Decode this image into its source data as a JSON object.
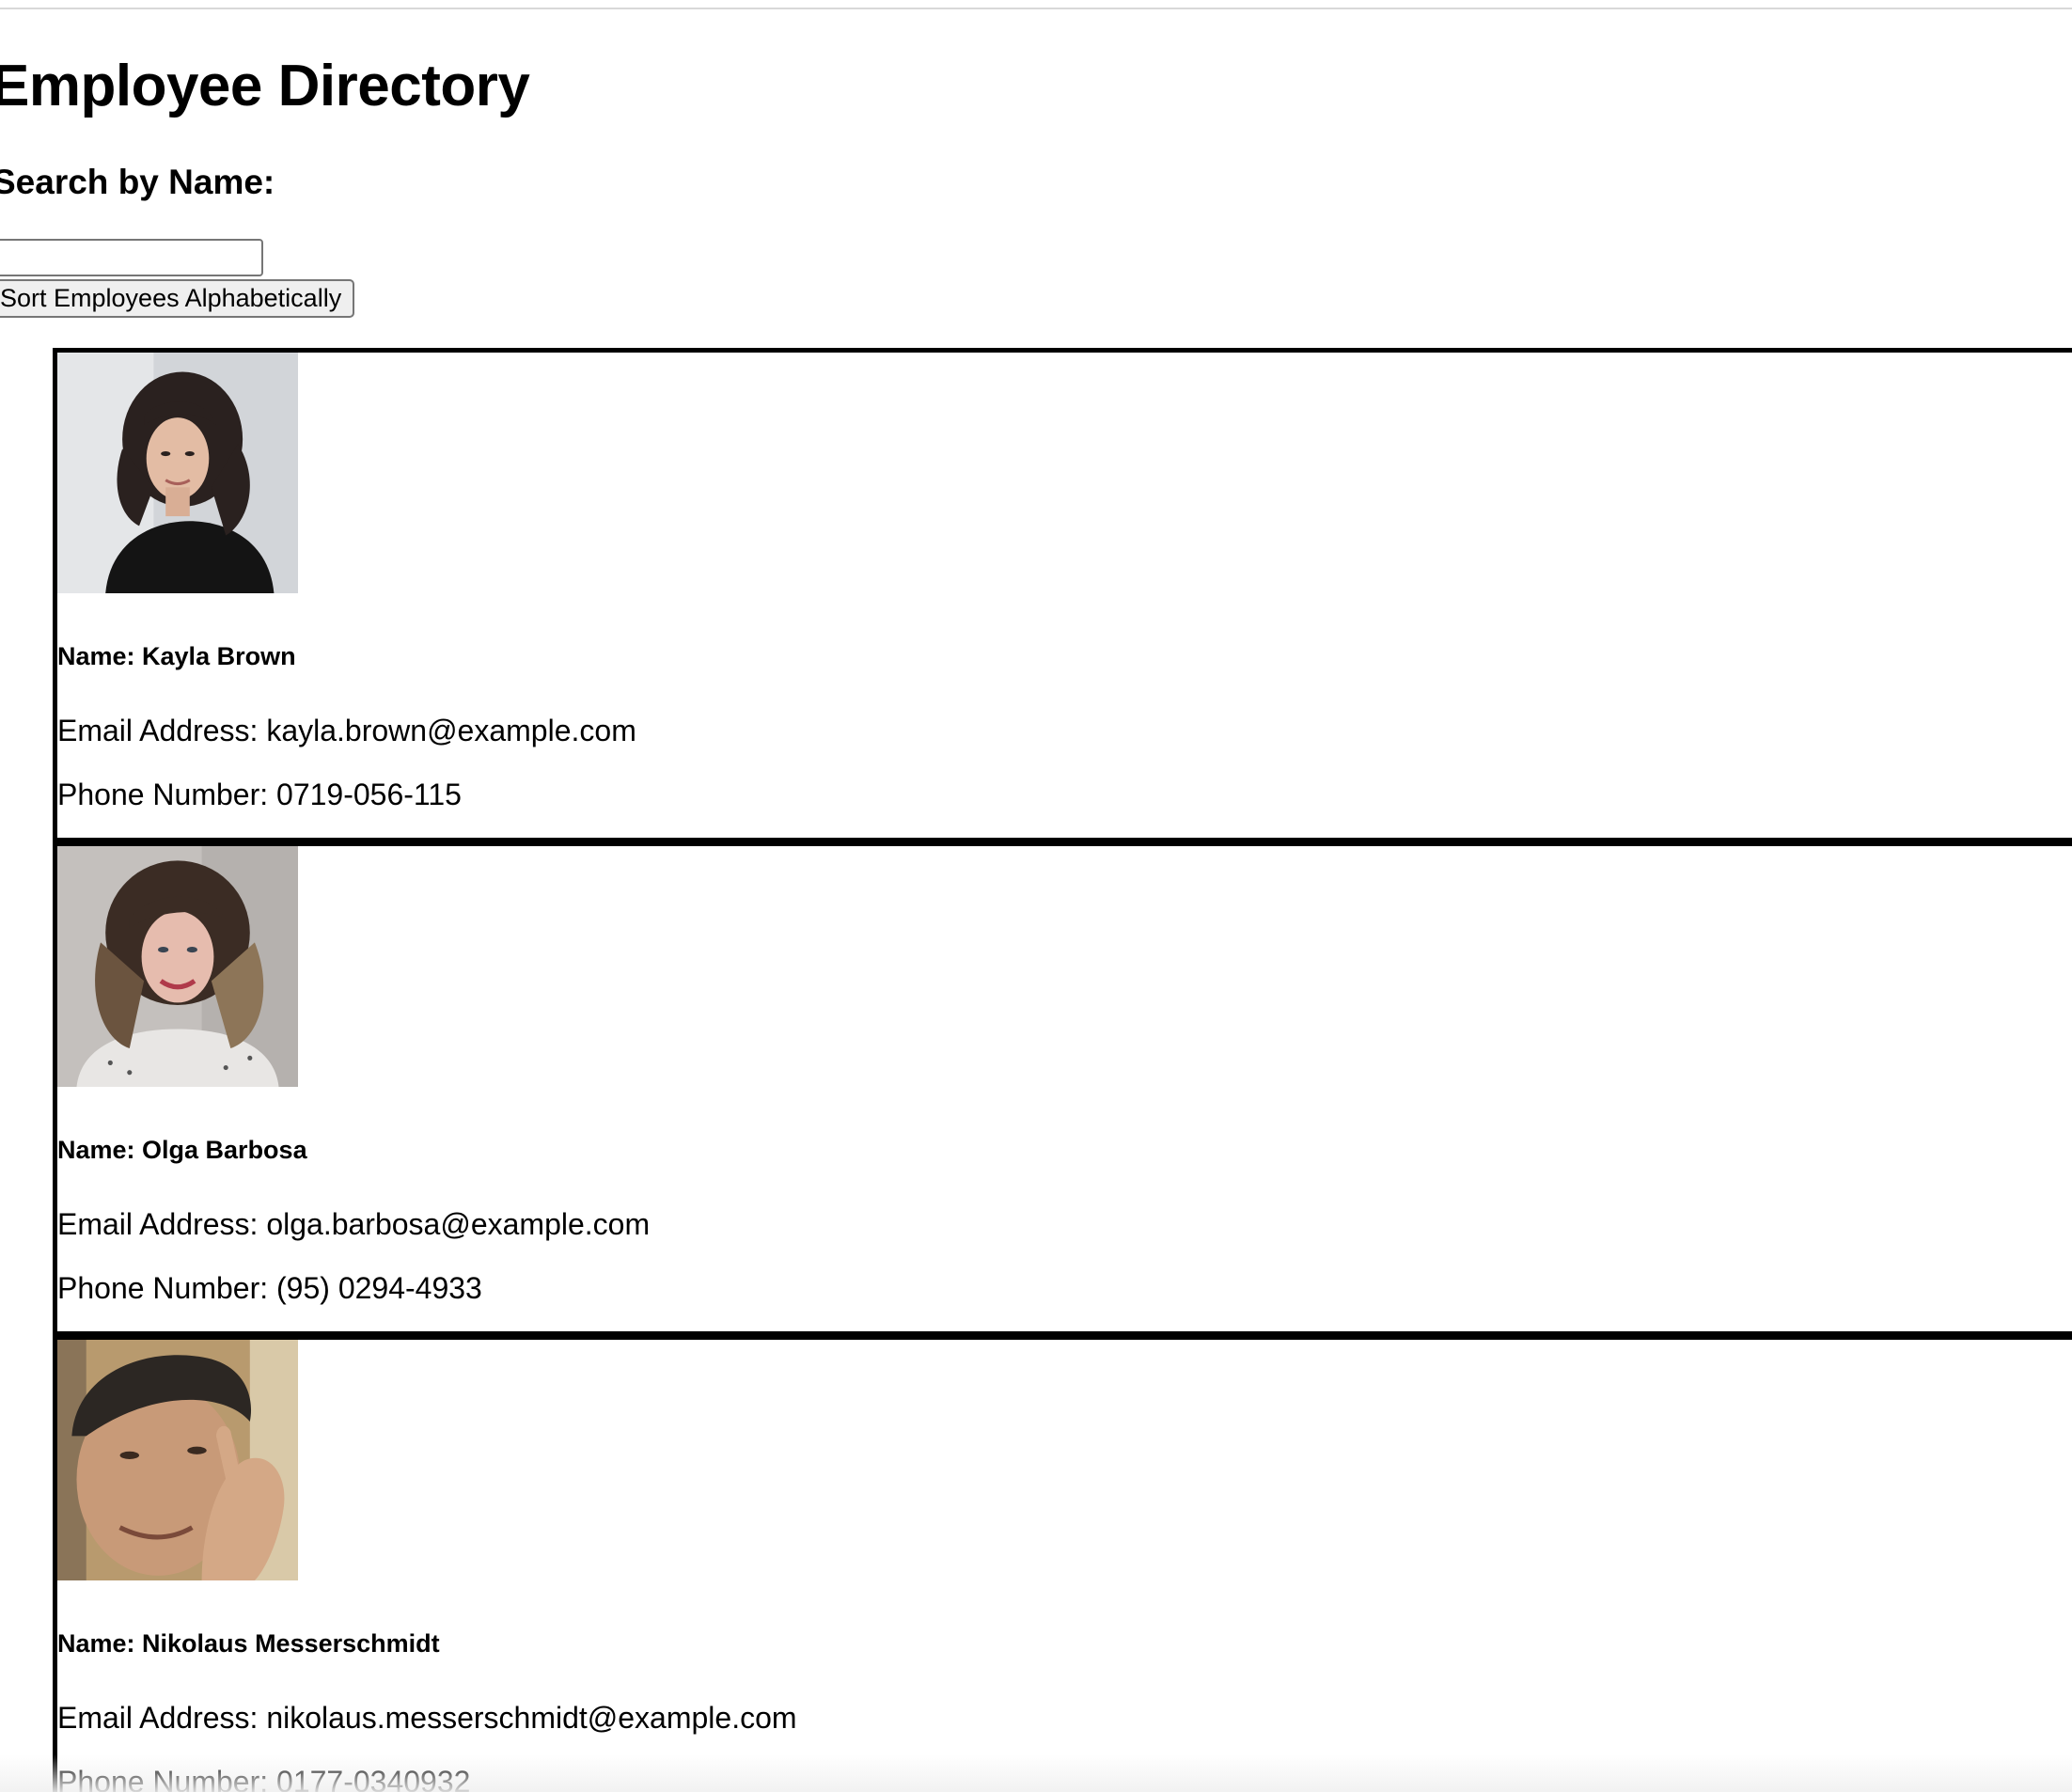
{
  "page": {
    "title": "Employee Directory"
  },
  "search": {
    "label": "Search by Name:",
    "value": "",
    "placeholder": ""
  },
  "toolbar": {
    "sort_label": "Sort Employees Alphabetically"
  },
  "employees": [
    {
      "name": "Name: Kayla Brown",
      "email": "Email Address: kayla.brown@example.com",
      "phone": "Phone Number: 0719-056-115",
      "photo": "woman-dark-hair-portrait",
      "colors": {
        "bg": "#cfd2d6",
        "hair": "#2a211f",
        "skin": "#e3bca4",
        "clothes": "#141414"
      }
    },
    {
      "name": "Name: Olga Barbosa",
      "email": "Email Address: olga.barbosa@example.com",
      "phone": "Phone Number: (95) 0294-4933",
      "photo": "woman-wavy-hair-portrait",
      "colors": {
        "bg": "#bdb9b6",
        "hair": "#3b2c24",
        "skin": "#e6bcae",
        "clothes": "#e8e6e4"
      }
    },
    {
      "name": "Name: Nikolaus Messerschmidt",
      "email": "Email Address: nikolaus.messerschmidt@example.com",
      "phone": "Phone Number: 0177-0340932",
      "photo": "man-dark-hair-portrait",
      "colors": {
        "bg": "#b89a6e",
        "hair": "#2c2723",
        "skin": "#c89a78",
        "clothes": "#5a4a3c"
      }
    }
  ]
}
